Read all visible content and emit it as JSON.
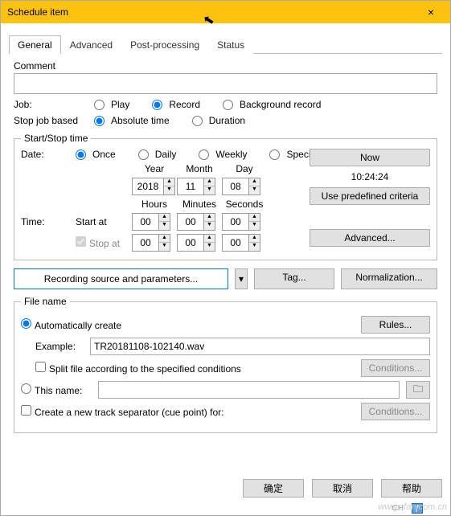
{
  "window": {
    "title": "Schedule item",
    "close": "×"
  },
  "tabs": {
    "general": "General",
    "advanced": "Advanced",
    "post": "Post-processing",
    "status": "Status"
  },
  "general": {
    "comment_label": "Comment",
    "comment_value": "",
    "job_label": "Job:",
    "job": {
      "play": "Play",
      "record": "Record",
      "bgrecord": "Background record"
    },
    "stop_label": "Stop job based",
    "stop": {
      "absolute": "Absolute time",
      "duration": "Duration"
    }
  },
  "sst": {
    "legend": "Start/Stop time",
    "date_label": "Date:",
    "freq": {
      "once": "Once",
      "daily": "Daily",
      "weekly": "Weekly",
      "special": "Special"
    },
    "hdr": {
      "year": "Year",
      "month": "Month",
      "day": "Day",
      "hours": "Hours",
      "minutes": "Minutes",
      "seconds": "Seconds"
    },
    "date": {
      "year": "2018",
      "month": "11",
      "day": "08"
    },
    "time_label": "Time:",
    "start_at": "Start at",
    "stop_at": "Stop at",
    "start": {
      "h": "00",
      "m": "00",
      "s": "00"
    },
    "stop": {
      "h": "00",
      "m": "00",
      "s": "00"
    },
    "now_btn": "Now",
    "clock": "10:24:24",
    "criteria_btn": "Use predefined criteria",
    "adv_btn": "Advanced..."
  },
  "mid": {
    "recording_src": "Recording source and parameters...",
    "tag": "Tag...",
    "normalization": "Normalization..."
  },
  "fn": {
    "legend": "File name",
    "auto": "Automatically create",
    "rules": "Rules...",
    "example_label": "Example:",
    "example_value": "TR20181108-102140.wav",
    "split": "Split file according to the specified conditions",
    "conditions": "Conditions...",
    "thisname": "This name:",
    "thisname_value": "",
    "cue": "Create a new track separator (cue point) for:"
  },
  "footer": {
    "ok": "确定",
    "cancel": "取消",
    "help": "帮助"
  },
  "watermark": "www.cfan.com.cn",
  "lang": {
    "ch": "CH",
    "pill": "ƒ"
  }
}
